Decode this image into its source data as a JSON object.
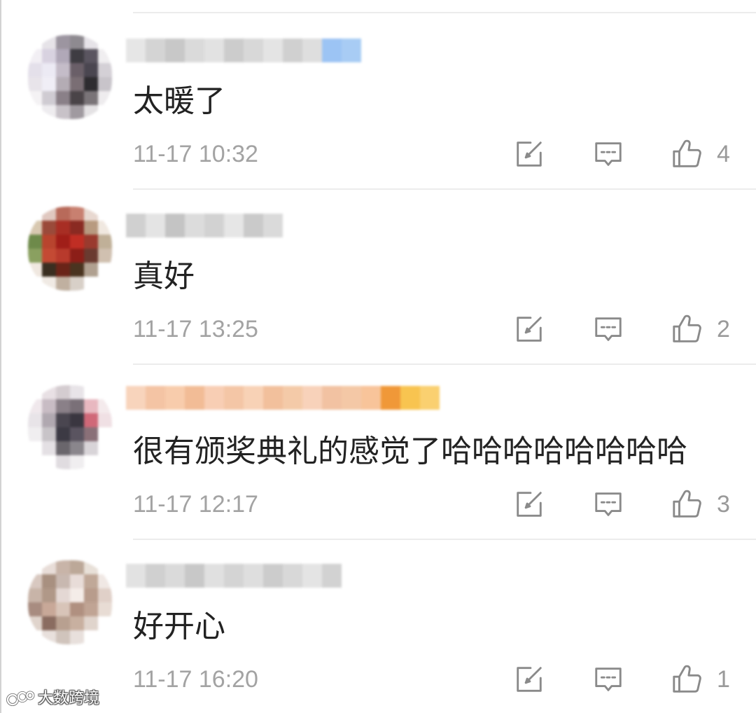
{
  "comments": [
    {
      "text": "太暖了",
      "time": "11-17 10:32",
      "likes": 4,
      "avatar_mosaic": [
        "#ffffff",
        "#e6e3e8",
        "#9c95a0",
        "#8e8a90",
        "#e6e3e8",
        "#ffffff",
        "#f2eff4",
        "#d8d2e0",
        "#b0a8b8",
        "#3e3c42",
        "#5a5560",
        "#f0eef0",
        "#e4e0ea",
        "#eceaf4",
        "#c4bcc8",
        "#6a5f68",
        "#4a4650",
        "#d4d0d6",
        "#e8e4ea",
        "#f0eef6",
        "#b4acb4",
        "#7a6e74",
        "#2e2c30",
        "#c8c4ca",
        "#f4f2f4",
        "#cfcbd2",
        "#8a8088",
        "#4a4448",
        "#7a7478",
        "#eeecee",
        "#ffffff",
        "#eeecef",
        "#c8c2c8",
        "#a09aa0",
        "#e4e2e4",
        "#ffffff"
      ],
      "name_blur": [
        "#e6e6e6",
        "#d4d4d4",
        "#c8c8c8",
        "#dadada",
        "#e2e2e2",
        "#cccccc",
        "#d8d8d8",
        "#e4e4e4",
        "#d0d0d0",
        "#dedede",
        "#9cc4f4",
        "#a8ccf4"
      ]
    },
    {
      "text": "真好",
      "time": "11-17 13:25",
      "likes": 2,
      "avatar_mosaic": [
        "#ffffff",
        "#e0c8c0",
        "#b86a5a",
        "#c88070",
        "#e8d8d0",
        "#ffffff",
        "#d8c8b0",
        "#9a4a3a",
        "#a82e24",
        "#8a2a22",
        "#b89a80",
        "#f0e8e0",
        "#6e8a4a",
        "#b8442e",
        "#a01e18",
        "#c02e24",
        "#9a3a2e",
        "#c0b098",
        "#8aa060",
        "#c44a34",
        "#b83a2c",
        "#8c1e18",
        "#6a3a30",
        "#d0c0b0",
        "#f0e8e0",
        "#3a2e20",
        "#6a2418",
        "#4a3420",
        "#b0a090",
        "#ffffff",
        "#ffffff",
        "#f0eae4",
        "#c0b0a0",
        "#d8d0c8",
        "#ffffff",
        "#ffffff"
      ],
      "name_blur": [
        "#d0d0d0",
        "#e4e4e4",
        "#c4c4c4",
        "#dcdcdc",
        "#d2d2d2",
        "#e6e6e6",
        "#cacaca",
        "#dadada"
      ]
    },
    {
      "text": "很有颁奖典礼的感觉了哈哈哈哈哈哈哈哈",
      "time": "11-17 12:17",
      "likes": 3,
      "avatar_mosaic": [
        "#ffffff",
        "#e8e0e4",
        "#d4ccd0",
        "#e8e4e8",
        "#ffffff",
        "#ffffff",
        "#f0e8ec",
        "#c8bcc4",
        "#8a8088",
        "#7a7078",
        "#e8b8c0",
        "#f4eaec",
        "#e8e4e8",
        "#b0a8b0",
        "#4a4650",
        "#3a3640",
        "#d06878",
        "#f0e0e4",
        "#f0eef0",
        "#c8c4c8",
        "#3c3a44",
        "#5a5460",
        "#8a7078",
        "#ffffff",
        "#ffffff",
        "#e4e0e4",
        "#6a666c",
        "#8a868c",
        "#d8d4d8",
        "#ffffff",
        "#ffffff",
        "#ffffff",
        "#e0dce0",
        "#f0eef0",
        "#ffffff",
        "#ffffff"
      ],
      "name_blur": [
        "#f8d4bc",
        "#f4c4a4",
        "#f8ccac",
        "#f2bc96",
        "#f8ceb4",
        "#f4c6a6",
        "#f8d2b6",
        "#f2c09c",
        "#f4caa8",
        "#f8d2ba",
        "#f2c2a2",
        "#f4c8a6",
        "#f8c49a",
        "#f09838",
        "#f8c450",
        "#fad070"
      ]
    },
    {
      "text": "好开心",
      "time": "11-17 16:20",
      "likes": 1,
      "avatar_mosaic": [
        "#ffffff",
        "#e8ddd8",
        "#c8b4a8",
        "#bca898",
        "#e8e0d8",
        "#ffffff",
        "#d8c8c0",
        "#a89080",
        "#c8b8b0",
        "#e8dcd8",
        "#c0a898",
        "#f0e8e4",
        "#c8b4a8",
        "#b09888",
        "#e4d8d4",
        "#f4ece8",
        "#b89c8c",
        "#e0d0c8",
        "#a88c80",
        "#c8a898",
        "#d8c4b8",
        "#b09080",
        "#c0a494",
        "#e8dcd4",
        "#e0d4cc",
        "#8a6c60",
        "#b8a090",
        "#c8b0a0",
        "#e0d4cc",
        "#ffffff",
        "#ffffff",
        "#e8e0dc",
        "#d0c4bc",
        "#e8e0dc",
        "#ffffff",
        "#ffffff"
      ],
      "name_blur": [
        "#e2e2e2",
        "#d0d0d0",
        "#dadada",
        "#c8c8c8",
        "#e0e0e0",
        "#d4d4d4",
        "#dedede",
        "#cccccc",
        "#d8d8d8",
        "#e4e4e4",
        "#d2d2d2"
      ]
    }
  ],
  "icons": {
    "repost": "repost-icon",
    "reply": "comment-icon",
    "like": "thumbs-up-icon"
  },
  "watermark": {
    "text": "大数跨境"
  },
  "colors": {
    "text": "#222222",
    "meta": "#a3a3a3",
    "icon": "#8a8a8a",
    "divider": "#ececec"
  }
}
